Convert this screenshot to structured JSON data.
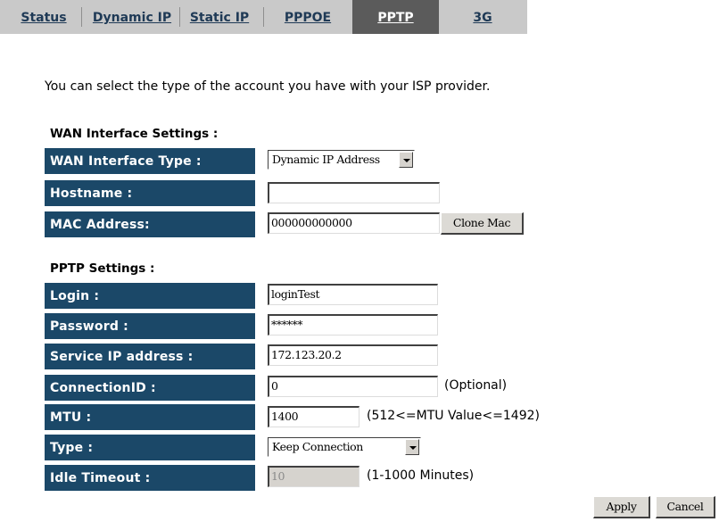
{
  "tabs": [
    {
      "label": "Status",
      "active": false
    },
    {
      "label": "Dynamic IP",
      "active": false
    },
    {
      "label": "Static IP",
      "active": false
    },
    {
      "label": "PPPOE",
      "active": false
    },
    {
      "label": "PPTP",
      "active": true
    },
    {
      "label": "3G",
      "active": false
    }
  ],
  "intro": "You can select the type of the account you have with your ISP provider.",
  "wan": {
    "section_title": "WAN Interface Settings :",
    "interface_type": {
      "label": "WAN Interface Type :",
      "value": "Dynamic IP Address"
    },
    "hostname": {
      "label": "Hostname :",
      "value": ""
    },
    "mac": {
      "label": "MAC Address:",
      "value": "000000000000",
      "button": "Clone Mac"
    }
  },
  "pptp": {
    "section_title": "PPTP Settings :",
    "login": {
      "label": "Login :",
      "value": "loginTest"
    },
    "password": {
      "label": "Password :",
      "value": "******"
    },
    "service_ip": {
      "label": "Service IP address :",
      "value": "172.123.20.2"
    },
    "connection_id": {
      "label": "ConnectionID :",
      "value": "0",
      "hint": "(Optional)"
    },
    "mtu": {
      "label": "MTU :",
      "value": "1400",
      "hint": "(512<=MTU Value<=1492)"
    },
    "type": {
      "label": "Type :",
      "value": "Keep Connection"
    },
    "idle_timeout": {
      "label": "Idle Timeout :",
      "value": "10",
      "hint": "(1-1000 Minutes)"
    }
  },
  "actions": {
    "apply": "Apply",
    "cancel": "Cancel"
  },
  "colors": {
    "label_bg": "#1b4868",
    "tab_bar": "#c9c9c9",
    "tab_active": "#5b5b5b",
    "tab_text": "#1f3a56"
  }
}
